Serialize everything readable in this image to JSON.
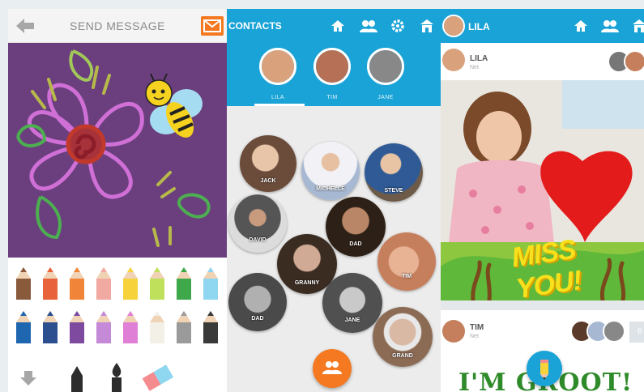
{
  "send_message": {
    "title": "SEND MESSAGE",
    "header_icons": [
      "back-arrow-icon",
      "mail-icon"
    ],
    "pencil_colors_row1": [
      "#8a5a3c",
      "#e8633b",
      "#f0853a",
      "#f2a9a2",
      "#f6d33c",
      "#bfe05a",
      "#3ea84a",
      "#8fd6f0"
    ],
    "pencil_colors_row2": [
      "#1f66b0",
      "#2c4f8f",
      "#7d4aa0",
      "#c48ad8",
      "#e07fd6",
      "#f3f0e8",
      "#9a9a9a",
      "#3a3a3a"
    ],
    "tools": [
      "down-arrow-icon",
      "marker-icon",
      "brush-icon",
      "eraser-icon"
    ]
  },
  "contacts": {
    "title": "CONTACTS",
    "header_icons": [
      "home-icon",
      "group-icon",
      "gear-icon",
      "inbox-icon"
    ],
    "top_contacts": [
      {
        "name": "LILA",
        "color": "#d9a27c"
      },
      {
        "name": "TIM",
        "color": "#b57055"
      },
      {
        "name": "JANE",
        "color": "#888888"
      }
    ],
    "bubbles": [
      {
        "name": "JACK",
        "color": "#6b4c3b"
      },
      {
        "name": "MICHELLE",
        "color": "#a7b8d3"
      },
      {
        "name": "STEVE",
        "color": "#6d5a48"
      },
      {
        "name": "DAVID",
        "color": "#3b3b3b"
      },
      {
        "name": "DAD",
        "color": "#6a4a33"
      },
      {
        "name": "GRANNY",
        "color": "#8a7b70"
      },
      {
        "name": "TIM",
        "color": "#d79c7a"
      },
      {
        "name": "DAD",
        "color": "#9a9a9a"
      },
      {
        "name": "JANE",
        "color": "#7b7b7b"
      },
      {
        "name": "GRAND",
        "color": "#8c6b55"
      }
    ],
    "fab_icon": "add-group-icon"
  },
  "feed": {
    "title": "LILA",
    "header_icons": [
      "home-icon",
      "group-icon",
      "inbox-icon"
    ],
    "cards": [
      {
        "name": "LILA",
        "sub": "Net"
      },
      {
        "name": "TIM",
        "sub": "Net"
      }
    ],
    "miss_text": "MISS YOU!",
    "groot_text": "I'M GROOT!",
    "extra_count": "6",
    "fab_icon": "pencil-icon"
  }
}
